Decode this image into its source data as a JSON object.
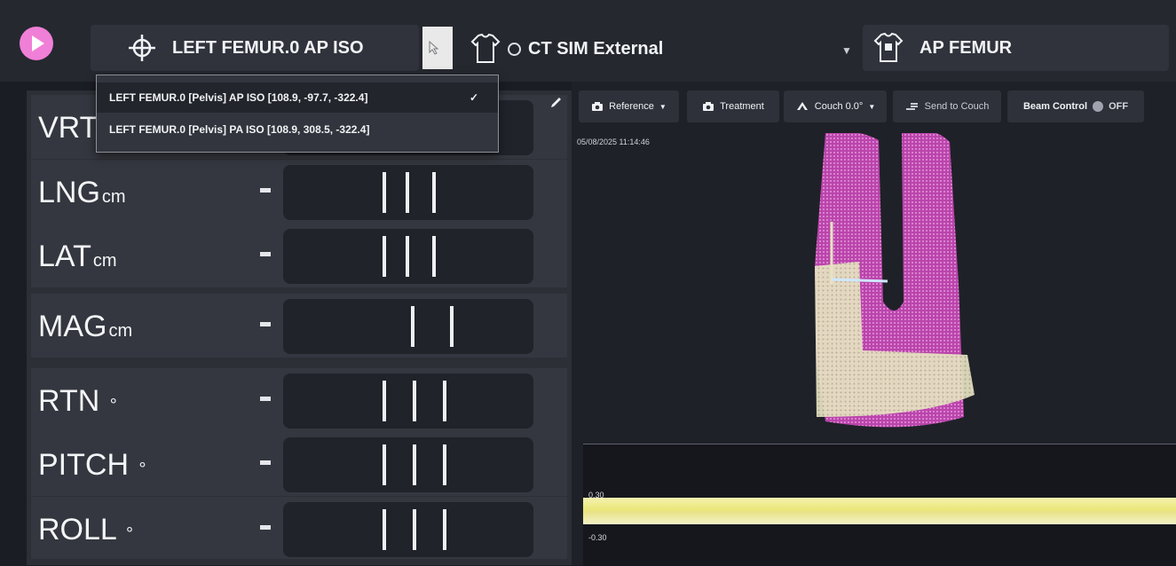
{
  "header": {
    "iso_label": "LEFT FEMUR.0 AP ISO",
    "external_label": "CT SIM External",
    "plan_label": "AP FEMUR"
  },
  "iso_dropdown": {
    "items": [
      {
        "label": "LEFT FEMUR.0 [Pelvis] AP ISO  [108.9, -97.7, -322.4]",
        "selected": true,
        "check": "✓"
      },
      {
        "label": "LEFT FEMUR.0 [Pelvis] PA ISO  [108.9, 308.5, -322.4]",
        "selected": false
      }
    ]
  },
  "metrics": [
    {
      "name": "VRT",
      "unit": "",
      "value": ""
    },
    {
      "name": "LNG",
      "unit": "cm",
      "value": "-"
    },
    {
      "name": "LAT",
      "unit": "cm",
      "value": "-"
    },
    {
      "name": "MAG",
      "unit": "cm",
      "value": "-"
    },
    {
      "name": "RTN",
      "unit": "°",
      "value": "-"
    },
    {
      "name": "PITCH",
      "unit": "°",
      "value": "-"
    },
    {
      "name": "ROLL",
      "unit": "°",
      "value": "-"
    }
  ],
  "toolbar": {
    "reference_label": "Reference",
    "treatment_label": "Treatment",
    "couch_label": "Couch 0.0°",
    "send_label": "Send to Couch",
    "beam_label": "Beam Control",
    "beam_state": "OFF"
  },
  "viewport": {
    "timestamp": "05/08/2025 11:14:46"
  },
  "graph": {
    "top_label": "0.30",
    "bottom_label": "-0.30"
  },
  "colors": {
    "accent_pink": "#f07fd7",
    "surface_pink": "#d756c5",
    "treatment_cream": "#e9e6c6"
  }
}
